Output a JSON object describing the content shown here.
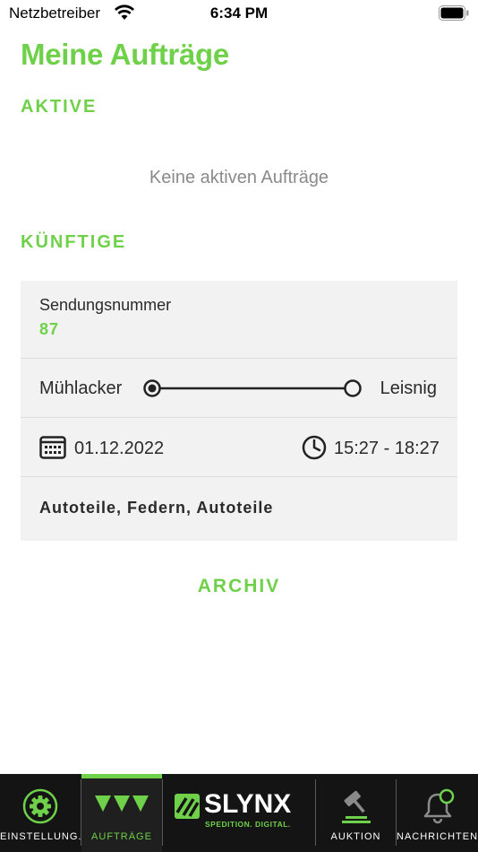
{
  "status_bar": {
    "carrier": "Netzbetreiber",
    "time": "6:34 PM"
  },
  "page": {
    "title": "Meine Aufträge"
  },
  "sections": {
    "active": {
      "title": "AKTIVE",
      "empty_message": "Keine aktiven Aufträge"
    },
    "future": {
      "title": "KÜNFTIGE"
    }
  },
  "order": {
    "number_label": "Sendungsnummer",
    "number": "87",
    "from": "Mühlacker",
    "to": "Leisnig",
    "date": "01.12.2022",
    "time_window": "15:27 - 18:27",
    "goods": "Autoteile, Federn, Autoteile"
  },
  "archive": {
    "label": "ARCHIV"
  },
  "tabbar": {
    "items": [
      {
        "label": "EINSTELLUNG...",
        "icon": "gear-icon",
        "active": false
      },
      {
        "label": "AUFTRÄGE",
        "icon": "orders-icon",
        "active": true
      },
      {
        "label": "",
        "icon": "slynx-logo",
        "active": false
      },
      {
        "label": "AUKTION",
        "icon": "gavel-icon",
        "active": false
      },
      {
        "label": "NACHRICHTEN",
        "icon": "bell-icon",
        "active": false
      }
    ],
    "logo_text": "SLYNX",
    "logo_tagline": "SPEDITION. DIGITAL."
  },
  "colors": {
    "accent": "#6fd14a",
    "tabbar_bg": "#141414",
    "card_bg": "#f2f2f2"
  }
}
